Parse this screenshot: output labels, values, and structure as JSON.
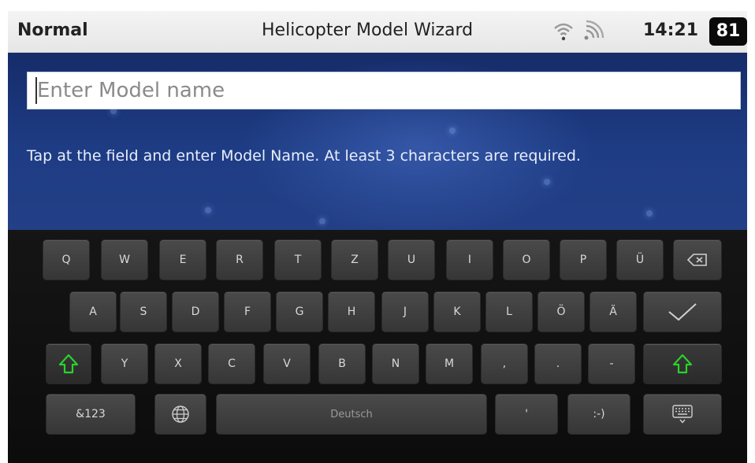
{
  "status_bar": {
    "mode": "Normal",
    "title": "Helicopter Model Wizard",
    "wifi_icon": "wifi-icon",
    "signal_icon": "signal-icon",
    "time": "14:21",
    "battery": "81"
  },
  "form": {
    "name_placeholder": "Enter Model name",
    "name_value": "",
    "hint": "Tap at the field and enter Model Name. At least 3 characters are required."
  },
  "keyboard": {
    "row1": [
      "Q",
      "W",
      "E",
      "R",
      "T",
      "Z",
      "U",
      "I",
      "O",
      "P",
      "Ü"
    ],
    "row2": [
      "A",
      "S",
      "D",
      "F",
      "G",
      "H",
      "J",
      "K",
      "L",
      "Ö",
      "Ä"
    ],
    "row3": [
      "Y",
      "X",
      "C",
      "V",
      "B",
      "N",
      "M",
      ",",
      ".",
      "-"
    ],
    "numbers_label": "&123",
    "space_label": "Deutsch",
    "apostrophe_label": "'",
    "smiley_label": ":-)",
    "icons": {
      "backspace": "backspace-icon",
      "enter": "checkmark-icon",
      "shift": "shift-icon",
      "language": "globe-icon",
      "hide": "hide-keyboard-icon"
    },
    "accent_color": "#2bd12b"
  }
}
